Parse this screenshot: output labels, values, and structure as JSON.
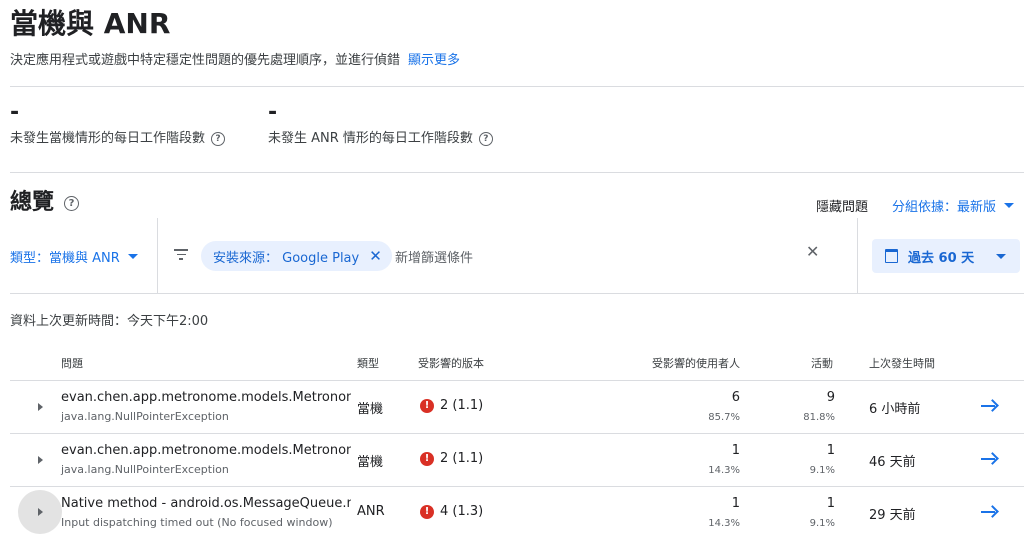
{
  "header": {
    "title": "當機與 ANR",
    "subtitle": "決定應用程式或遊戲中特定穩定性問題的優先處理順序，並進行偵錯",
    "learn_more": "顯示更多"
  },
  "metrics": [
    {
      "value": "-",
      "label": "未發生當機情形的每日工作階段數"
    },
    {
      "value": "-",
      "label": "未發生 ANR 情形的每日工作階段數"
    }
  ],
  "overview": {
    "title": "總覽",
    "hide_issues": "隱藏問題",
    "group_by": "分組依據：最新版"
  },
  "filters": {
    "type": "類型：當機與 ANR",
    "chip": "安裝來源： Google Play",
    "add_placeholder": "新增篩選條件",
    "date_range": "過去 60 天"
  },
  "updated": "資料上次更新時間：今天下午2:00",
  "table": {
    "headers": {
      "issue": "問題",
      "type": "類型",
      "versions": "受影響的版本",
      "users": "受影響的使用者人",
      "events": "活動",
      "last_seen": "上次發生時間"
    },
    "rows": [
      {
        "title": "evan.chen.app.metronome.models.MetronomeRepository",
        "subtitle": "java.lang.NullPointerException",
        "type": "當機",
        "version": "2 (1.1)",
        "users": "6",
        "users_pct": "85.7%",
        "events": "9",
        "events_pct": "81.8%",
        "last_seen": "6 小時前"
      },
      {
        "title": "evan.chen.app.metronome.models.MetronomeRepository",
        "subtitle": "java.lang.NullPointerException",
        "type": "當機",
        "version": "2 (1.1)",
        "users": "1",
        "users_pct": "14.3%",
        "events": "1",
        "events_pct": "9.1%",
        "last_seen": "46 天前"
      },
      {
        "title": "Native method - android.os.MessageQueue.nativePollOnce",
        "subtitle": "Input dispatching timed out (No focused window)",
        "type": "ANR",
        "version": "4 (1.3)",
        "users": "1",
        "users_pct": "14.3%",
        "events": "1",
        "events_pct": "9.1%",
        "last_seen": "29 天前"
      }
    ]
  }
}
